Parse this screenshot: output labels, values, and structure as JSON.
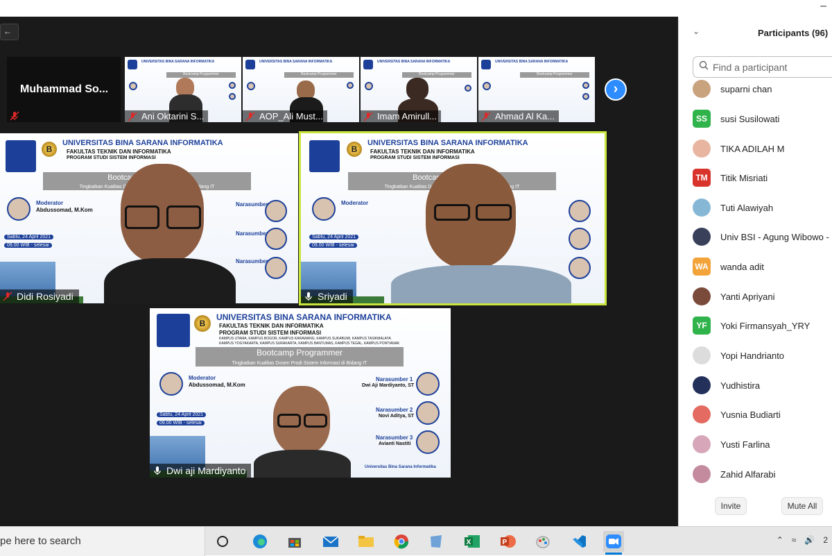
{
  "window": {
    "minimize_glyph": "–"
  },
  "meeting": {
    "view_toggle": "←",
    "pinned_name_tile": "Muhammad  So...",
    "thumbnails": [
      {
        "name": "Ani Oktarini S..."
      },
      {
        "name": "AOP_Ali Must..."
      },
      {
        "name": "Imam Amirull..."
      },
      {
        "name": "Ahmad Al Ka..."
      }
    ],
    "next_glyph": "›",
    "speakers": [
      {
        "name": "Didi Rosiyadi"
      },
      {
        "name": "Sriyadi"
      },
      {
        "name": "Dwi aji Mardiyanto"
      }
    ],
    "poster": {
      "university": "UNIVERSITAS BINA SARANA INFORMATIKA",
      "faculty": "FAKULTAS TEKNIK DAN INFORMATIKA",
      "program": "PROGRAM STUDI SISTEM INFORMASI",
      "campuses_1": "KAMPUS UTAMA, KAMPUS BOGOR, KAMPUS KARAWANG, KAMPUS SUKABUMI, KAMPUS TASIKMALAYA",
      "campuses_2": "KAMPUS YOGYAKARTA, KAMPUS SURAKARTA, KAMPUS BANTUMAS, KAMPUS TEGAL, KAMPUS PONTIANAK",
      "event": "Bootcamp Programmer",
      "tagline": "Tingkatkan Kualitas Dosen Prodi Sistem Informasi di Bidang IT",
      "moderator_label": "Moderator",
      "moderator_name": "Abdussomad, M.Kom",
      "narasumber_1": "Narasumber 1",
      "narasumber_1_name": "Dwi Aji Mardiyanto, ST",
      "narasumber_2": "Narasumber 2",
      "narasumber_2_name": "Novi Aditya, ST",
      "narasumber_3": "Narasumber 3",
      "narasumber_3_name": "Avianti Nastiti",
      "date": "Sabtu, 24 April 2021",
      "time": "09.00 WIB - selesai",
      "logo_text": "UNIVERSITAS",
      "badge_text": "B",
      "zoom_text": "Zoom",
      "footer": "Universitas Bina Sarana Informatika"
    }
  },
  "participants_panel": {
    "title": "Participants (96)",
    "search_placeholder": "Find a participant",
    "participants": [
      {
        "name": "suparni chan",
        "avatar_type": "photo",
        "color": "#c9a27e"
      },
      {
        "name": "susi Susilowati",
        "avatar_type": "initials",
        "initials": "SS",
        "color": "#2fb34a"
      },
      {
        "name": "TIKA ADILAH M",
        "avatar_type": "photo",
        "color": "#e8b6a0"
      },
      {
        "name": "Titik Misriati",
        "avatar_type": "initials",
        "initials": "TM",
        "color": "#d9342b"
      },
      {
        "name": "Tuti Alawiyah",
        "avatar_type": "photo",
        "color": "#86b8d6"
      },
      {
        "name": "Univ BSI - Agung Wibowo -",
        "avatar_type": "photo",
        "color": "#39405a"
      },
      {
        "name": "wanda adit",
        "avatar_type": "initials",
        "initials": "WA",
        "color": "#f2a33a"
      },
      {
        "name": "Yanti Apriyani",
        "avatar_type": "photo",
        "color": "#7a4a3a"
      },
      {
        "name": "Yoki Firmansyah_YRY",
        "avatar_type": "initials",
        "initials": "YF",
        "color": "#2fb34a"
      },
      {
        "name": "Yopi Handrianto",
        "avatar_type": "photo",
        "color": "#dcdcdc"
      },
      {
        "name": "Yudhistira",
        "avatar_type": "photo",
        "color": "#23305a"
      },
      {
        "name": "Yusnia Budiarti",
        "avatar_type": "photo",
        "color": "#e36b62"
      },
      {
        "name": "Yusti Farlina",
        "avatar_type": "photo",
        "color": "#d7a7b9"
      },
      {
        "name": "Zahid Alfarabi",
        "avatar_type": "photo",
        "color": "#c48b9f"
      }
    ],
    "invite_label": "Invite",
    "mute_all_label": "Mute All"
  },
  "taskbar": {
    "search_text": "pe here to search",
    "tray_time": "2"
  }
}
